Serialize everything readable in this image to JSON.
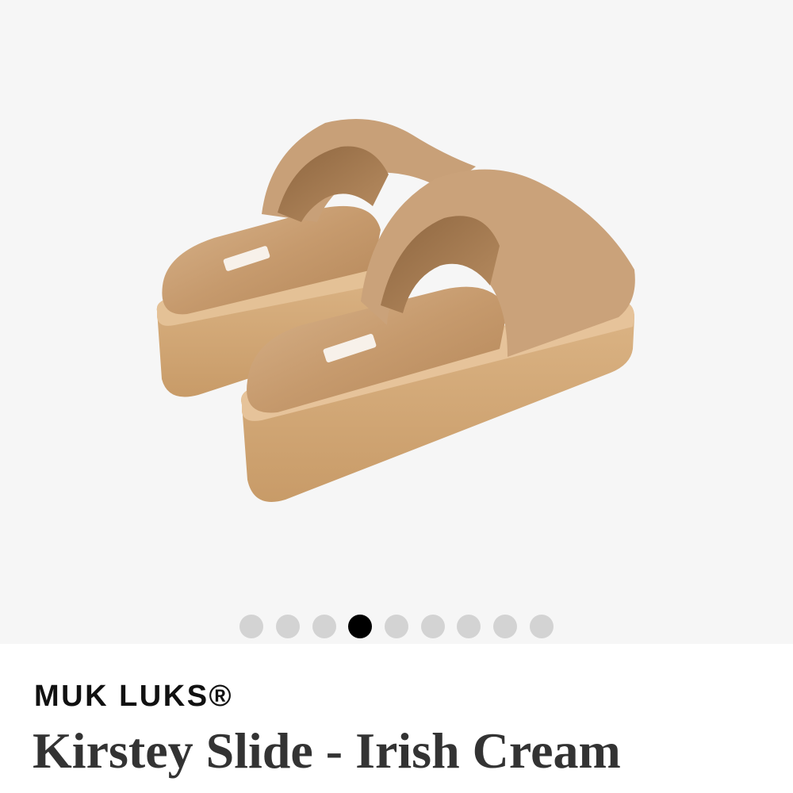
{
  "product": {
    "brand": "MUK LUKS®",
    "name": "Kirstey Slide - Irish Cream",
    "image_alt": "Kirstey Slide fuzzy platform slippers, rear view",
    "colors": {
      "fur": "#c89e72",
      "sole": "#d2aa79",
      "gallery_bg": "#f6f6f6"
    }
  },
  "gallery": {
    "slide_count": 9,
    "active_slide": 4,
    "dot_color": "#d3d3d3",
    "active_dot_color": "#000000"
  }
}
